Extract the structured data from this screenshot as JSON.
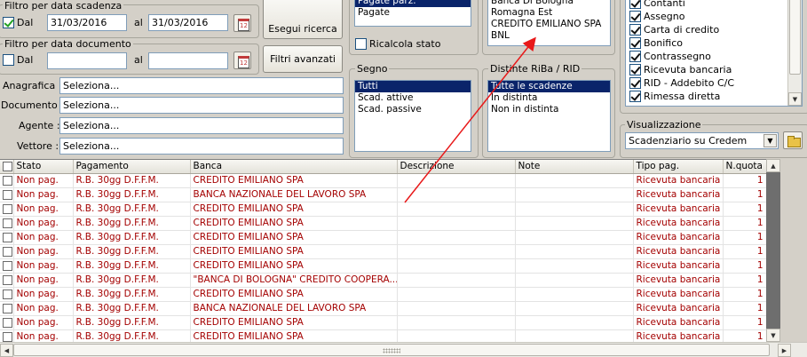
{
  "filtro_scadenza": {
    "title": "Filtro per data scadenza",
    "dal_label": "Dal",
    "dal_checked": true,
    "dal_value": "31/03/2016",
    "al_label": "al",
    "al_value": "31/03/2016"
  },
  "filtro_documento": {
    "title": "Filtro per data documento",
    "dal_label": "Dal",
    "dal_checked": false,
    "dal_value": "",
    "al_label": "al",
    "al_value": ""
  },
  "calendar_icon_text": "12",
  "buttons": {
    "esegui": "Esegui ricerca",
    "filtri": "Filtri avanzati"
  },
  "lookups": [
    {
      "label": "Anagrafica :",
      "value": "Seleziona..."
    },
    {
      "label": "Documento :",
      "value": "Seleziona..."
    },
    {
      "label": "Agente :",
      "value": "Seleziona..."
    },
    {
      "label": "Vettore :",
      "value": "Seleziona..."
    }
  ],
  "stato_list": {
    "items": [
      "Pagate parz.",
      "Pagate"
    ],
    "selected": 0
  },
  "ricalcola": {
    "label": "Ricalcola stato",
    "checked": false
  },
  "segno": {
    "title": "Segno",
    "items": [
      "Tutti",
      "Scad. attive",
      "Scad. passive"
    ],
    "selected": 0
  },
  "banche_list": {
    "items": [
      "Banca Di Bologna",
      "Romagna Est",
      "CREDITO EMILIANO SPA",
      "BNL"
    ]
  },
  "distinte": {
    "title": "Distinte RiBa / RID",
    "items": [
      "Tutte le scadenze",
      "In distinta",
      "Non in distinta"
    ],
    "selected": 0
  },
  "pagamenti": {
    "items": [
      "Contanti",
      "Assegno",
      "Carta di credito",
      "Bonifico",
      "Contrassegno",
      "Ricevuta bancaria",
      "RID - Addebito C/C",
      "Rimessa diretta"
    ]
  },
  "visualizzazione": {
    "title": "Visualizzazione",
    "value": "Scadenziario su Credem"
  },
  "grid": {
    "columns": [
      "",
      "Stato",
      "Pagamento",
      "Banca",
      "Descrizione",
      "Note",
      "Tipo pag.",
      "N.quota"
    ],
    "rows": [
      [
        "Non pag.",
        "R.B. 30gg D.F.F.M.",
        "CREDITO EMILIANO SPA",
        "",
        "",
        "Ricevuta bancaria",
        "1"
      ],
      [
        "Non pag.",
        "R.B. 30gg D.F.F.M.",
        "BANCA NAZIONALE DEL LAVORO SPA",
        "",
        "",
        "Ricevuta bancaria",
        "1"
      ],
      [
        "Non pag.",
        "R.B. 30gg D.F.F.M.",
        "CREDITO EMILIANO SPA",
        "",
        "",
        "Ricevuta bancaria",
        "1"
      ],
      [
        "Non pag.",
        "R.B. 30gg D.F.F.M.",
        "CREDITO EMILIANO SPA",
        "",
        "",
        "Ricevuta bancaria",
        "1"
      ],
      [
        "Non pag.",
        "R.B. 30gg D.F.F.M.",
        "CREDITO EMILIANO SPA",
        "",
        "",
        "Ricevuta bancaria",
        "1"
      ],
      [
        "Non pag.",
        "R.B. 30gg D.F.F.M.",
        "CREDITO EMILIANO SPA",
        "",
        "",
        "Ricevuta bancaria",
        "1"
      ],
      [
        "Non pag.",
        "R.B. 30gg D.F.F.M.",
        "CREDITO EMILIANO SPA",
        "",
        "",
        "Ricevuta bancaria",
        "1"
      ],
      [
        "Non pag.",
        "R.B. 30gg D.F.F.M.",
        "\"BANCA DI BOLOGNA\" CREDITO  COOPERA...",
        "",
        "",
        "Ricevuta bancaria",
        "1"
      ],
      [
        "Non pag.",
        "R.B. 30gg D.F.F.M.",
        "CREDITO EMILIANO SPA",
        "",
        "",
        "Ricevuta bancaria",
        "1"
      ],
      [
        "Non pag.",
        "R.B. 30gg D.F.F.M.",
        "BANCA NAZIONALE DEL LAVORO SPA",
        "",
        "",
        "Ricevuta bancaria",
        "1"
      ],
      [
        "Non pag.",
        "R.B. 30gg D.F.F.M.",
        "CREDITO EMILIANO SPA",
        "",
        "",
        "Ricevuta bancaria",
        "1"
      ],
      [
        "Non pag.",
        "R.B. 30gg D.F.F.M.",
        "CREDITO EMILIANO SPA",
        "",
        "",
        "Ricevuta bancaria",
        "1"
      ]
    ]
  },
  "colors": {
    "row_text": "#a40000",
    "selection": "#0a246a",
    "annotation_arrow": "#e8191a"
  }
}
